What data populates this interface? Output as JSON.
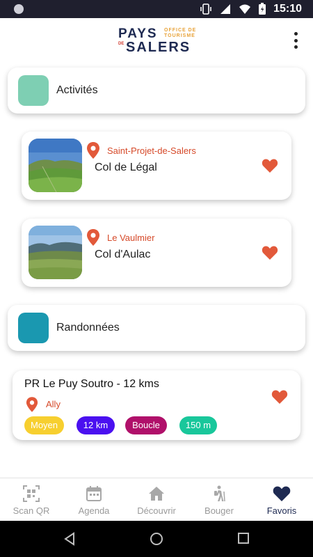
{
  "status_bar": {
    "time": "15:10"
  },
  "header": {
    "logo": {
      "line1": "PAYS",
      "tag1": "OFFICE DE",
      "tag2": "TOURISME",
      "de": "DE",
      "line2": "SALERS"
    }
  },
  "categories": [
    {
      "label": "Activités",
      "color": "#7ecfb3"
    },
    {
      "label": "Randonnées",
      "color": "#1a98b0"
    }
  ],
  "activities": [
    {
      "place": "Saint-Projet-de-Salers",
      "title": "Col de Légal"
    },
    {
      "place": "Le Vaulmier",
      "title": "Col d'Aulac"
    }
  ],
  "trail": {
    "title": "PR Le Puy Soutro - 12 kms",
    "place": "Ally",
    "tags": [
      {
        "label": "Moyen",
        "bg": "#f7cf2f",
        "fg": "#ffffff"
      },
      {
        "label": "12 km",
        "bg": "#4a10f0",
        "fg": "#ffffff"
      },
      {
        "label": "Boucle",
        "bg": "#b0106a",
        "fg": "#ffffff"
      },
      {
        "label": "150 m",
        "bg": "#19c79b",
        "fg": "#ffffff"
      }
    ]
  },
  "tabs": [
    {
      "label": "Scan QR",
      "icon": "qr-code-icon"
    },
    {
      "label": "Agenda",
      "icon": "calendar-icon"
    },
    {
      "label": "Découvrir",
      "icon": "home-icon"
    },
    {
      "label": "Bouger",
      "icon": "hiker-icon"
    },
    {
      "label": "Favoris",
      "icon": "heart-icon",
      "active": true
    }
  ],
  "colors": {
    "accent": "#e2593a",
    "brand": "#1e2a52",
    "logo_orange": "#e8a33a"
  }
}
